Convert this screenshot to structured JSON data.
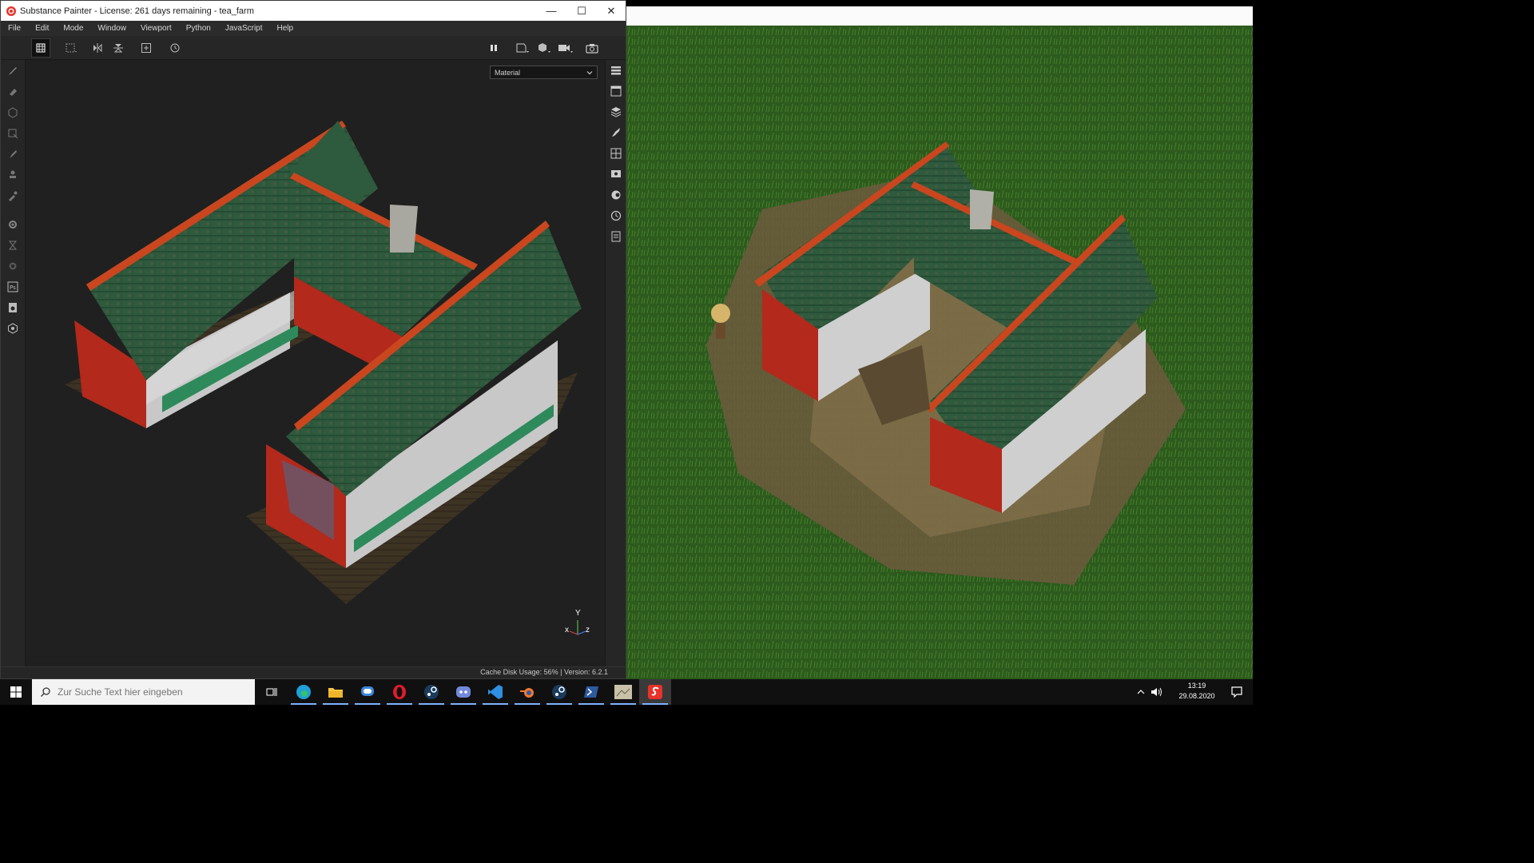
{
  "window": {
    "title": "Substance Painter - License: 261 days remaining - tea_farm",
    "minimize": "—",
    "maximize": "☐",
    "close": "✕"
  },
  "menu": [
    "File",
    "Edit",
    "Mode",
    "Window",
    "Viewport",
    "Python",
    "JavaScript",
    "Help"
  ],
  "viewport": {
    "channel_select": "Material",
    "axis": {
      "y": "Y",
      "x": "x",
      "z": "z"
    }
  },
  "status": {
    "text": "Cache Disk Usage:   56% | Version: 6.2.1"
  },
  "taskbar": {
    "search_placeholder": "Zur Suche Text hier eingeben",
    "time": "13:19",
    "date": "29.08.2020",
    "apps": [
      "task-view",
      "edge",
      "file-explorer",
      "app-blue-bubble",
      "opera",
      "steam",
      "discord",
      "vs-code",
      "blender",
      "steam-2",
      "powershell",
      "game-thumbnail",
      "substance-painter"
    ]
  },
  "colors": {
    "roof_green": "#2f5a3c",
    "wall_red": "#b02a1e",
    "wall_white": "#d8d8d8",
    "grass": "#2f6b1e",
    "dirt": "#7a6a4a",
    "accent_orange": "#c9461f"
  }
}
